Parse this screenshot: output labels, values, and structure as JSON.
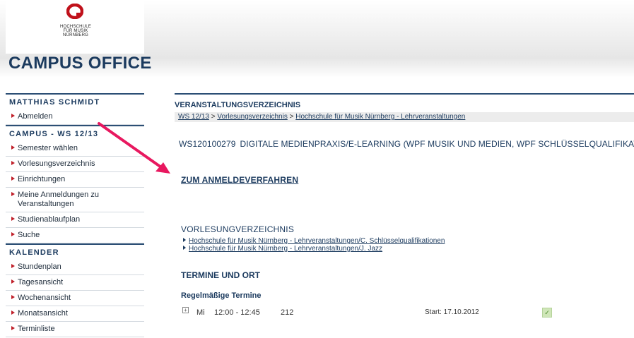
{
  "header": {
    "logo_lines": [
      "HOCHSCHULE",
      "FÜR MUSIK",
      "NÜRNBERG"
    ],
    "app_title": "CAMPUS OFFICE"
  },
  "sidebar": {
    "user_heading": "MATTHIAS SCHMIDT",
    "user_items": [
      {
        "label": "Abmelden"
      }
    ],
    "campus_heading": "CAMPUS - WS 12/13",
    "campus_items": [
      {
        "label": "Semester wählen"
      },
      {
        "label": "Vorlesungsverzeichnis"
      },
      {
        "label": "Einrichtungen"
      },
      {
        "label": "Meine Anmeldungen zu Veranstaltungen"
      },
      {
        "label": "Studienablaufplan"
      },
      {
        "label": "Suche"
      }
    ],
    "calendar_heading": "KALENDER",
    "calendar_items": [
      {
        "label": "Stundenplan"
      },
      {
        "label": "Tagesansicht"
      },
      {
        "label": "Wochenansicht"
      },
      {
        "label": "Monatsansicht"
      },
      {
        "label": "Terminliste"
      }
    ]
  },
  "main": {
    "section_title": "VERANSTALTUNGSVERZEICHNIS",
    "breadcrumb": [
      "WS 12/13",
      "Vorlesungsverzeichnis",
      "Hochschule für Musik Nürnberg - Lehrveranstaltungen"
    ],
    "breadcrumb_sep": " > ",
    "course_code": "WS120100279",
    "course_name": "DIGITALE MEDIENPRAXIS/E-LEARNING (WPF MUSIK UND MEDIEN, WPF SCHLÜSSELQUALIFIKATI",
    "registration_link": "ZUM ANMELDEVERFAHREN",
    "catalog_title": "VORLESUNGVERZEICHNIS",
    "catalog_links": [
      "Hochschule für Musik Nürnberg - Lehrveranstaltungen/C. Schlüsselqualifikationen",
      "Hochschule für Musik Nürnberg - Lehrveranstaltungen/J. Jazz"
    ],
    "schedule_title": "TERMINE UND ORT",
    "regular_title": "Regelmäßige Termine",
    "appointment": {
      "expand": "+",
      "day": "Mi",
      "time": "12:00 - 12:45",
      "room": "212",
      "start": "Start: 17.10.2012",
      "status_icon": "check-icon"
    }
  },
  "annotation": {
    "color": "#e8185f"
  }
}
